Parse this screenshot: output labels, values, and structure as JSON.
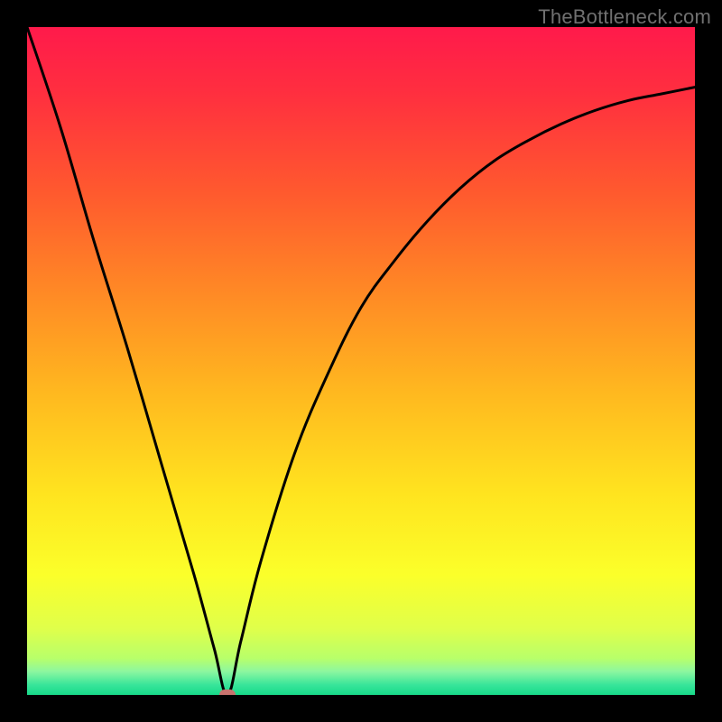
{
  "watermark": "TheBottleneck.com",
  "gradient": {
    "stops": [
      {
        "offset": 0.0,
        "color": "#ff1a4b"
      },
      {
        "offset": 0.1,
        "color": "#ff2f3f"
      },
      {
        "offset": 0.25,
        "color": "#ff5a2e"
      },
      {
        "offset": 0.4,
        "color": "#ff8a25"
      },
      {
        "offset": 0.55,
        "color": "#ffb91f"
      },
      {
        "offset": 0.7,
        "color": "#ffe41f"
      },
      {
        "offset": 0.82,
        "color": "#fbff2a"
      },
      {
        "offset": 0.9,
        "color": "#e0ff4a"
      },
      {
        "offset": 0.945,
        "color": "#b8ff6a"
      },
      {
        "offset": 0.965,
        "color": "#8cf7a0"
      },
      {
        "offset": 0.985,
        "color": "#38e59a"
      },
      {
        "offset": 1.0,
        "color": "#17d989"
      }
    ]
  },
  "chart_data": {
    "type": "line",
    "title": "",
    "xlabel": "",
    "ylabel": "",
    "xlim": [
      0,
      100
    ],
    "ylim": [
      0,
      100
    ],
    "grid": false,
    "legend": false,
    "notch_x": 30,
    "marker": {
      "x": 30,
      "y": 0
    },
    "series": [
      {
        "name": "curve",
        "x": [
          0,
          5,
          10,
          15,
          20,
          25,
          28,
          30,
          32,
          35,
          40,
          45,
          50,
          55,
          60,
          65,
          70,
          75,
          80,
          85,
          90,
          95,
          100
        ],
        "values": [
          100,
          85,
          68,
          52,
          35,
          18,
          7,
          0,
          8,
          20,
          36,
          48,
          58,
          65,
          71,
          76,
          80,
          83,
          85.5,
          87.5,
          89,
          90,
          91
        ]
      }
    ]
  }
}
